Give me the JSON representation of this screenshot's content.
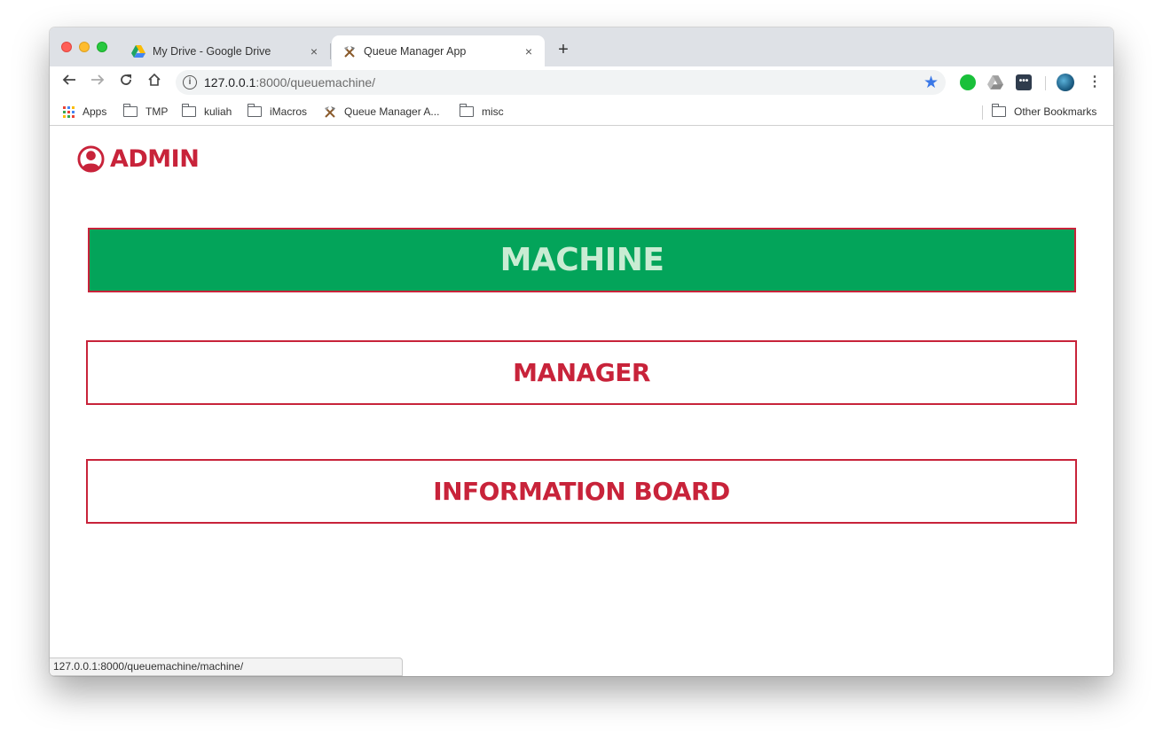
{
  "browser": {
    "tabs": [
      {
        "title": "My Drive - Google Drive",
        "favicon": "google-drive-icon",
        "active": false
      },
      {
        "title": "Queue Manager App",
        "favicon": "hammer-pick-icon",
        "active": true
      }
    ],
    "new_tab_icon": "+",
    "close_icon": "×",
    "url": {
      "host": "127.0.0.1",
      "rest": ":8000/queuemachine/"
    },
    "bookmarks": [
      {
        "label": "Apps",
        "icon": "apps-grid-icon"
      },
      {
        "label": "TMP",
        "icon": "folder-icon"
      },
      {
        "label": "kuliah",
        "icon": "folder-icon"
      },
      {
        "label": "iMacros",
        "icon": "folder-icon"
      },
      {
        "label": "Queue Manager A...",
        "icon": "hammer-pick-icon"
      },
      {
        "label": "misc",
        "icon": "folder-icon"
      }
    ],
    "other_bookmarks": "Other Bookmarks",
    "status_url": "127.0.0.1:8000/queuemachine/machine/"
  },
  "page": {
    "brand": "ADMIN",
    "menu": {
      "machine": "MACHINE",
      "manager": "MANAGER",
      "information_board": "INFORMATION BOARD"
    }
  },
  "colors": {
    "brand_red": "#c8233a",
    "machine_green": "#03a45a",
    "machine_text": "#c9ecd3"
  }
}
